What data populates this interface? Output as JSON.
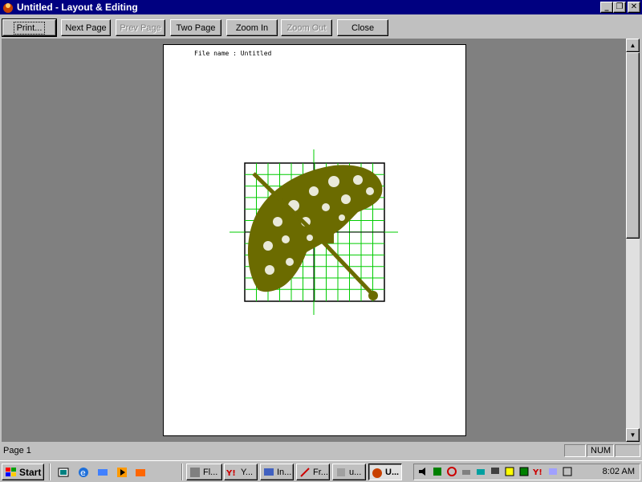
{
  "window": {
    "title": "Untitled - Layout & Editing"
  },
  "toolbar": {
    "buttons": [
      {
        "label": "Print...",
        "enabled": true
      },
      {
        "label": "Next Page",
        "enabled": true
      },
      {
        "label": "Prev Page",
        "enabled": false
      },
      {
        "label": "Two Page",
        "enabled": true
      },
      {
        "label": "Zoom In",
        "enabled": true
      },
      {
        "label": "Zoom Out",
        "enabled": false
      },
      {
        "label": "Close",
        "enabled": true
      }
    ]
  },
  "page": {
    "file_label": "File name : Untitled",
    "design_color": "#6b6b00",
    "grid_color": "#00cc00"
  },
  "statusbar": {
    "text": "Page 1",
    "pane_num": "NUM"
  },
  "taskbar": {
    "start_label": "Start",
    "tasks": [
      "Fl...",
      "Y...",
      "In...",
      "Fr...",
      "u...",
      "U..."
    ],
    "clock": "8:02 AM"
  }
}
